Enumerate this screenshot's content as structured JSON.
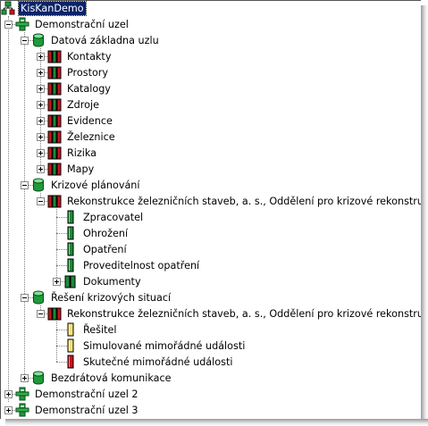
{
  "tree": {
    "root": {
      "label": "KisKanDemo",
      "icon": "network-icon",
      "selected": true
    },
    "demo1": {
      "label": "Demonstrační uzel",
      "db": {
        "label": "Datová základna uzlu",
        "items": [
          "Kontakty",
          "Prostory",
          "Katalogy",
          "Zdroje",
          "Evidence",
          "Železnice",
          "Rizika",
          "Mapy"
        ]
      },
      "krizove": {
        "label": "Krizové plánování",
        "org": {
          "label": "Rekonstrukce železničních staveb, a. s., Oddělení pro krizové rekonstrukce",
          "items": [
            "Zpracovatel",
            "Ohrožení",
            "Opatření",
            "Proveditelnost opatření",
            "Dokumenty"
          ]
        }
      },
      "reseni": {
        "label": "Řešení krizových situací",
        "org": {
          "label": "Rekonstrukce železničních staveb, a. s., Oddělení pro krizové rekonstrukce",
          "items": [
            "Řešitel",
            "Simulované mimořádné události",
            "Skutečné mimořádné události"
          ]
        }
      },
      "bezdr": {
        "label": "Bezdrátová komunikace"
      }
    },
    "demo2": {
      "label": "Demonstrační uzel 2"
    },
    "demo3": {
      "label": "Demonstrační uzel 3"
    }
  },
  "colors": {
    "selection": "#0a246a",
    "db": "#1f9a3a",
    "book_red": "#c8141c",
    "book_green": "#1e8a3a",
    "book_yellow": "#f4e27a"
  }
}
